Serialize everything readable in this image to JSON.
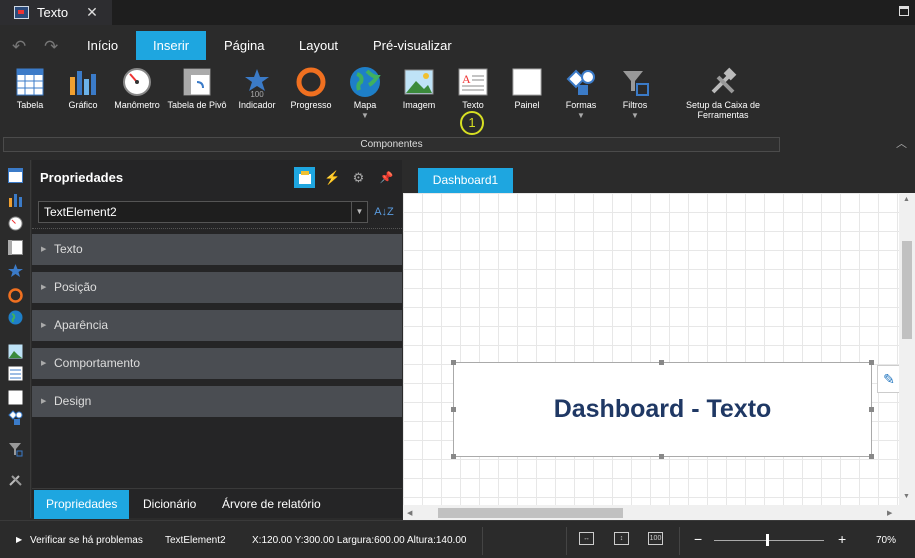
{
  "titlebar": {
    "doc_title": "Texto",
    "close_glyph": "✕"
  },
  "menu": {
    "undo": "↶",
    "redo": "↷",
    "items": [
      "Início",
      "Inserir",
      "Página",
      "Layout",
      "Pré-visualizar"
    ],
    "active_index": 1
  },
  "ribbon": {
    "tools": [
      {
        "label": "Tabela",
        "icon": "table-icon"
      },
      {
        "label": "Gráfico",
        "icon": "chart-icon"
      },
      {
        "label": "Manômetro",
        "icon": "gauge-icon"
      },
      {
        "label": "Tabela de Pivô",
        "icon": "pivot-icon"
      },
      {
        "label": "Indicador",
        "icon": "indicator-icon"
      },
      {
        "label": "Progresso",
        "icon": "progress-icon"
      },
      {
        "label": "Mapa",
        "icon": "globe-icon"
      },
      {
        "label": "Imagem",
        "icon": "image-icon"
      },
      {
        "label": "Texto",
        "icon": "text-icon"
      },
      {
        "label": "Painel",
        "icon": "panel-icon"
      },
      {
        "label": "Formas",
        "icon": "shapes-icon"
      },
      {
        "label": "Filtros",
        "icon": "filter-icon"
      },
      {
        "label": "Setup da Caixa de Ferramentas",
        "icon": "tools-icon"
      }
    ],
    "indicator_badge": "100",
    "group_label": "Componentes",
    "step_badge": "1"
  },
  "properties": {
    "title": "Propriedades",
    "selected_element": "TextElement2",
    "sort_glyph": "A↓Z",
    "categories": [
      "Texto",
      "Posição",
      "Aparência",
      "Comportamento",
      "Design"
    ],
    "bottom_tabs": [
      "Propriedades",
      "Dicionário",
      "Árvore de relatório"
    ]
  },
  "canvas": {
    "page_tab": "Dashboard1",
    "text_element": "Dashboard - Texto"
  },
  "status": {
    "check": "Verificar se há problemas",
    "element": "TextElement2",
    "geometry": "X:120.00 Y:300.00 Largura:600.00 Altura:140.00",
    "zoom": "70%",
    "zoom_minus": "−",
    "zoom_plus": "+"
  },
  "colors": {
    "accent": "#1ea6e0",
    "title_text": "#1f3864",
    "badge": "#d7df23"
  }
}
